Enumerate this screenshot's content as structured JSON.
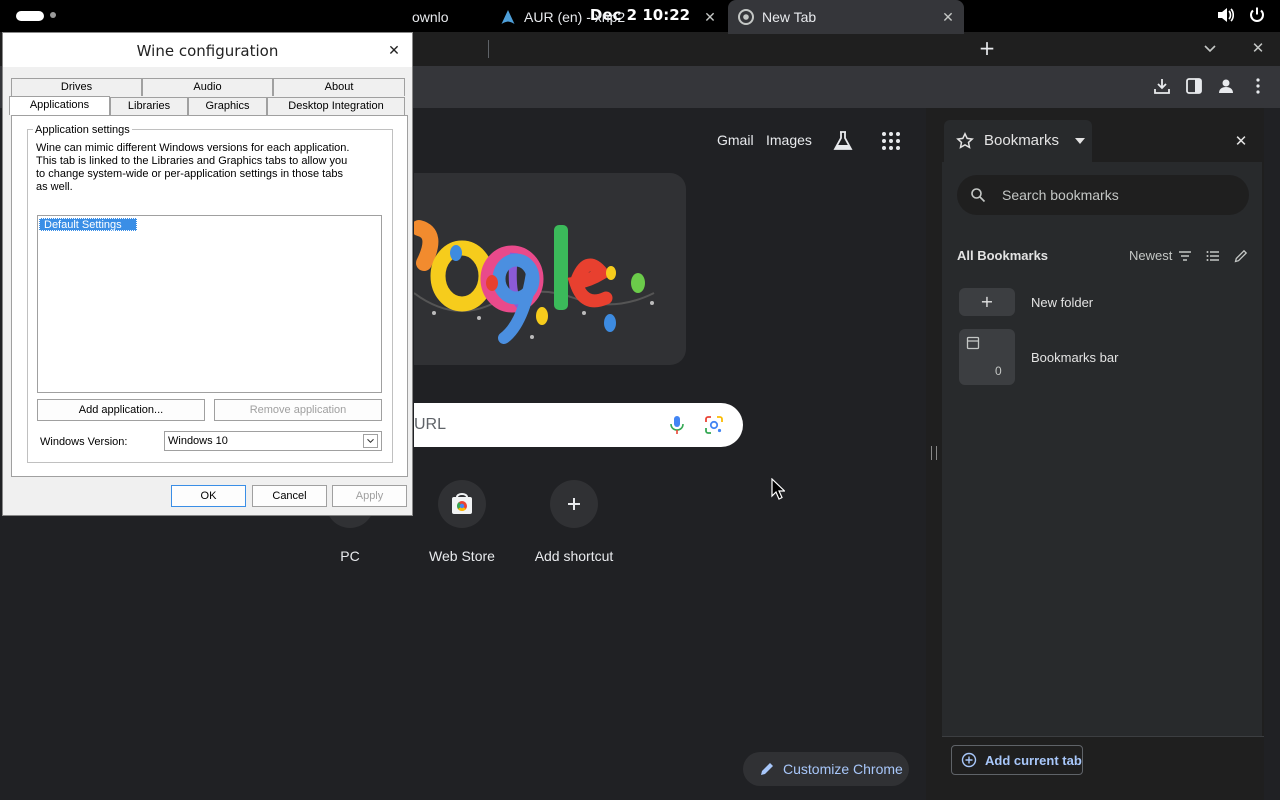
{
  "topbar": {
    "clock": "Dec 2  10:22"
  },
  "chrome": {
    "tabs": [
      {
        "title": "ownlo"
      },
      {
        "title": "AUR (en) - xnp2"
      },
      {
        "title": "New Tab"
      }
    ],
    "ntp": {
      "gmail": "Gmail",
      "images": "Images",
      "search_placeholder": "URL",
      "shortcuts": [
        {
          "label": "PC"
        },
        {
          "label": "Web Store"
        },
        {
          "label": "Add shortcut"
        }
      ],
      "customize": "Customize Chrome"
    },
    "bookmarks_panel": {
      "title": "Bookmarks",
      "search_placeholder": "Search bookmarks",
      "heading": "All Bookmarks",
      "sort": "Newest",
      "items": [
        {
          "label": "New folder"
        },
        {
          "label": "Bookmarks bar",
          "count": "0"
        }
      ],
      "add_current": "Add current tab"
    }
  },
  "wine": {
    "title": "Wine configuration",
    "tabs_row1": [
      "Drives",
      "Audio",
      "About"
    ],
    "tabs_row2": [
      "Applications",
      "Libraries",
      "Graphics",
      "Desktop Integration"
    ],
    "group_label": "Application settings",
    "description": "Wine can mimic different Windows versions for each application. This tab is linked to the Libraries and Graphics tabs to allow you to change system-wide or per-application settings in those tabs as well.",
    "list_items": [
      "Default Settings"
    ],
    "add_app": "Add application...",
    "remove_app": "Remove application",
    "winver_label": "Windows Version:",
    "winver_value": "Windows 10",
    "ok": "OK",
    "cancel": "Cancel",
    "apply": "Apply"
  }
}
